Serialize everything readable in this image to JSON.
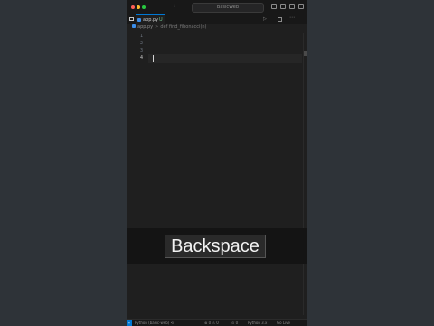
{
  "window": {
    "command_center": "BasicWeb"
  },
  "tabs": [
    {
      "label": "app.py",
      "marker": "U",
      "active": true
    }
  ],
  "breadcrumb": {
    "file": "app.py",
    "separator": ">",
    "symbol": "def find_fibonacci(n)"
  },
  "editor": {
    "line_numbers": [
      "1",
      "2",
      "3",
      "4"
    ],
    "current_line": "4"
  },
  "statusbar": {
    "branch": "Python (basic-web) ⟲",
    "problems": "⊗ 0 ⚠ 0",
    "ports": "⊙ 0",
    "python": "Python 3.x",
    "live": "Go Live"
  },
  "caption": {
    "key": "Backspace"
  },
  "icons": {
    "explorer": "files-icon",
    "run": "play-icon",
    "split": "split-editor-icon",
    "more": "ellipsis-icon"
  },
  "colors": {
    "background": "#2e3338",
    "editor": "#1f1f1f",
    "accent": "#0078d4",
    "caption_band": "#141414"
  }
}
